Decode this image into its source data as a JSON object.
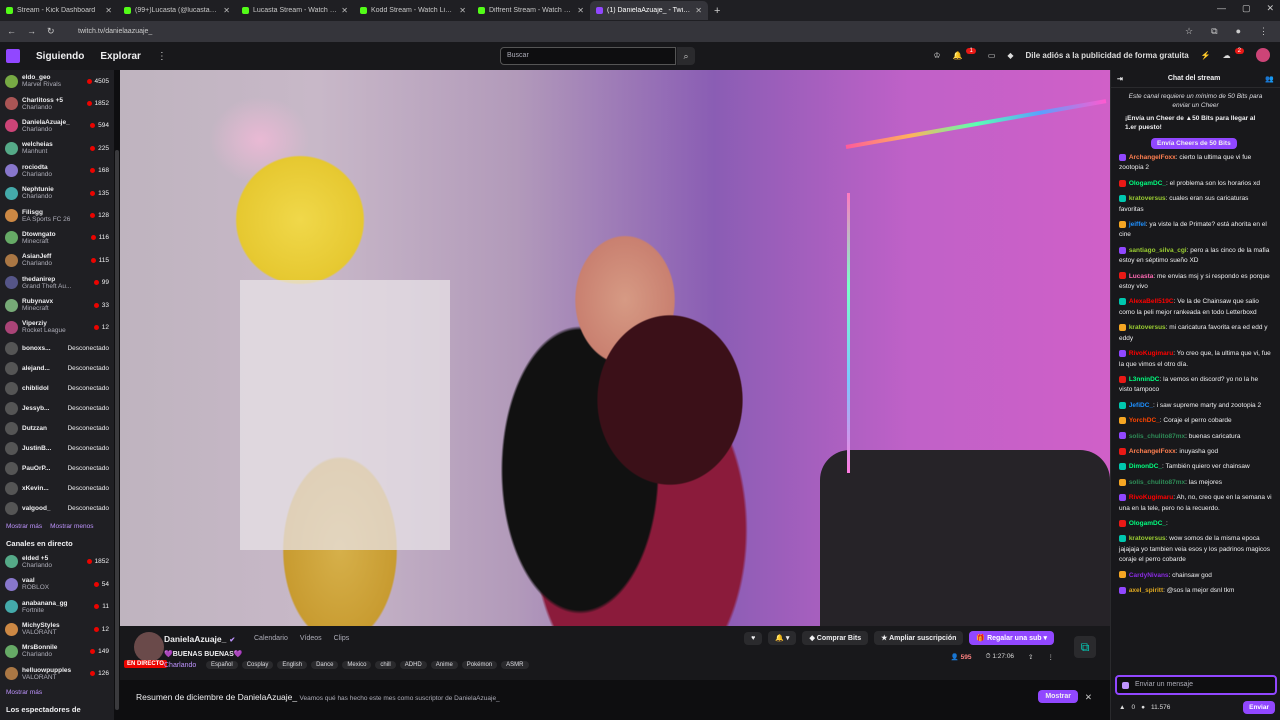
{
  "browser": {
    "tabs": [
      {
        "title": "Stream - Kick Dashboard",
        "type": "kick",
        "active": false
      },
      {
        "title": "(99+)Lucasta (@lucastastrike) | X",
        "type": "x",
        "active": false
      },
      {
        "title": "Lucasta Stream - Watch Live on Kick",
        "type": "kick",
        "active": false
      },
      {
        "title": "Kodd Stream - Watch Live on Kick",
        "type": "kick",
        "active": false
      },
      {
        "title": "Diffrent Stream - Watch Live on Kick",
        "type": "kick",
        "active": false
      },
      {
        "title": "(1) DanielaAzuaje_ - Twitch",
        "type": "twitch",
        "active": true
      }
    ],
    "url": "twitch.tv/danielaazuaje_"
  },
  "topnav": {
    "following": "Siguiendo",
    "explore": "Explorar",
    "search_placeholder": "Buscar",
    "notif_count": "1",
    "adfree": "Dile adiós a la publicidad de forma gratuita",
    "whisper_count": "2"
  },
  "sidebar": {
    "followed": [
      {
        "name": "eldo_geo",
        "game": "Marvel Rivals",
        "viewers": "4505"
      },
      {
        "name": "Charlitoss +5",
        "game": "Charlando",
        "viewers": "1852"
      },
      {
        "name": "DanielaAzuaje_",
        "game": "Charlando",
        "viewers": "594"
      },
      {
        "name": "welcheias",
        "game": "Manhunt",
        "viewers": "225"
      },
      {
        "name": "rociodta",
        "game": "Charlando",
        "viewers": "168"
      },
      {
        "name": "Nephtunie",
        "game": "Charlando",
        "viewers": "135"
      },
      {
        "name": "Filisgg",
        "game": "EA Sports FC 26",
        "viewers": "128"
      },
      {
        "name": "Dtowngato",
        "game": "Minecraft",
        "viewers": "116"
      },
      {
        "name": "AsianJeff",
        "game": "Charlando",
        "viewers": "115"
      },
      {
        "name": "thedanirep",
        "game": "Grand Theft Au...",
        "viewers": "99"
      },
      {
        "name": "Rubynavx",
        "game": "Minecraft",
        "viewers": "33"
      },
      {
        "name": "Viperziy",
        "game": "Rocket League",
        "viewers": "12"
      }
    ],
    "offline_label": "Desconectado",
    "offline": [
      "bonoxs...",
      "alejand...",
      "chiblidol",
      "Jessyb...",
      "Dutzzan",
      "JustinB...",
      "PauOrP...",
      "xKevin...",
      "valgood_"
    ],
    "show_more": "Mostrar más",
    "show_less": "Mostrar menos",
    "live_section": "Canales en directo",
    "live": [
      {
        "name": "elded +5",
        "game": "Charlando",
        "viewers": "1852"
      },
      {
        "name": "vaal",
        "game": "ROBLOX",
        "viewers": "54"
      },
      {
        "name": "anabanana_gg",
        "game": "Fortnite",
        "viewers": "11"
      },
      {
        "name": "MichyStyles",
        "game": "VALORANT",
        "viewers": "12"
      },
      {
        "name": "MrsBonnile",
        "game": "Charlando",
        "viewers": "149"
      },
      {
        "name": "helluowpupples",
        "game": "VALORANT",
        "viewers": "126"
      }
    ],
    "show_more2": "Mostrar más",
    "viewers_section": "Los espectadores de"
  },
  "stream": {
    "live_badge": "EN DIRECTO",
    "channel": "DanielaAzuaje_",
    "links": [
      "Calendario",
      "Vídeos",
      "Clips"
    ],
    "title": "💜BUENAS BUENAS💜",
    "category": "Charlando",
    "tags": [
      "Español",
      "Cosplay",
      "English",
      "Dance",
      "Mexico",
      "chill",
      "ADHD",
      "Anime",
      "Pokémon",
      "ASMR"
    ],
    "bits_button": "Comprar Bits",
    "expand_sub": "Ampliar suscripción",
    "gift_sub": "Regalar una sub",
    "viewers": "595",
    "uptime": "1:27:06"
  },
  "recap": {
    "title": "Resumen de diciembre de DanielaAzuaje_",
    "subtitle": "Veamos qué has hecho este mes como suscriptor de DanielaAzuaje_",
    "button": "Mostrar"
  },
  "chat": {
    "header": "Chat del stream",
    "cheer_notice": "Este canal requiere un mínimo de 50 Bits para enviar un Cheer",
    "cheer_first": "¡Envía un Cheer de ▲50 Bits para llegar al 1.er puesto!",
    "cheer_button": "Envía Cheers de 50 Bits",
    "messages": [
      {
        "user": "ArchangelFoxx",
        "color": "#ff7f50",
        "text": ": cierto la ultima que vi fue zootopia 2"
      },
      {
        "user": "OlogamDC_",
        "color": "#00ff7f",
        "text": ": el problema son los horarios xd"
      },
      {
        "user": "kratoversus",
        "color": "#9acd32",
        "text": ": cuales eran sus caricaturas favoritas"
      },
      {
        "user": "jeiffel",
        "color": "#1e90ff",
        "text": ": ya viste la de Primate? está ahorita en el cine"
      },
      {
        "user": "santiago_silva_cgi",
        "color": "#9acd32",
        "text": ": pero a las cinco de la mafia estoy en séptimo sueño XD"
      },
      {
        "user": "Lucasta",
        "color": "#ff69b4",
        "text": ": me envias msj y si respondo es porque estoy vivo"
      },
      {
        "user": "AlexaBell519C",
        "color": "#ff0000",
        "text": ": Ve la de Chainsaw que salio como la peli mejor rankeada en todo Letterboxd"
      },
      {
        "user": "kratoversus",
        "color": "#9acd32",
        "text": ": mi caricatura favorita era ed edd y eddy"
      },
      {
        "user": "RivoKugimaru",
        "color": "#ff0000",
        "text": ": Yo creo que, la ultima que vi, fue la que vimos el otro día."
      },
      {
        "user": "L3nninDC",
        "color": "#00ff7f",
        "text": ": la vemos en discord? yo no la he visto tampoco"
      },
      {
        "user": "JefiDC_",
        "color": "#1e90ff",
        "text": ": i saw supreme marty and zootopia 2"
      },
      {
        "user": "YorchDC_",
        "color": "#ff4500",
        "text": ": Coraje el perro cobarde"
      },
      {
        "user": "solis_chulito87mx",
        "color": "#2e8b57",
        "text": ": buenas caricatura"
      },
      {
        "user": "ArchangelFoxx",
        "color": "#ff7f50",
        "text": ": inuyasha god"
      },
      {
        "user": "DimonDC_",
        "color": "#00ff7f",
        "text": ": También quiero ver chainsaw"
      },
      {
        "user": "solis_chulito87mx",
        "color": "#2e8b57",
        "text": ": las mejores"
      },
      {
        "user": "RivoKugimaru",
        "color": "#ff0000",
        "text": ": Ah, no, creo que en la semana vi una en la tele, pero no la recuerdo."
      },
      {
        "user": "OlogamDC_",
        "color": "#00ff7f",
        "text": ":"
      },
      {
        "user": "kratoversus",
        "color": "#9acd32",
        "text": ": wow somos de la misma epoca jajajaja yo tambien veia esos y los padrinos magicos coraje el perro cobarde"
      },
      {
        "user": "CardyNivans",
        "color": "#8a2be2",
        "text": ": chainsaw god"
      },
      {
        "user": "axel_spiritt",
        "color": "#daa520",
        "text": ": @sos la mejor dsnl tkm"
      }
    ],
    "input_placeholder": "Enviar un mensaje",
    "bits_count": "0",
    "points": "11.576",
    "send": "Enviar"
  }
}
